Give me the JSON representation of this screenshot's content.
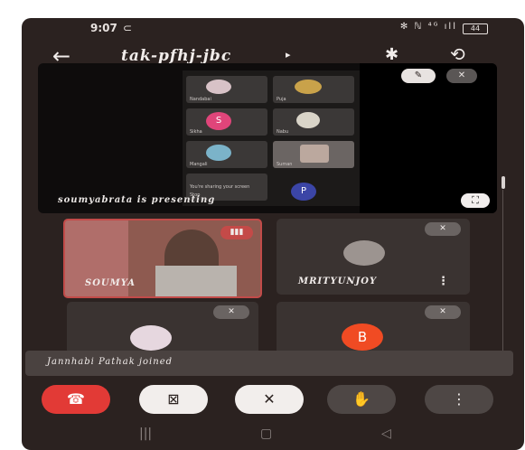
{
  "status": {
    "time": "9:07",
    "indicator": "⊂",
    "right": "✻ ℕ ⁴ᴳ ıll",
    "battery": "44"
  },
  "header": {
    "title": "tak-pfhj-jbc",
    "back_icon": "←",
    "play_icon": "▸",
    "bluetooth_icon": "✱",
    "rotate_icon": "⟲"
  },
  "screen_share": {
    "presenter_text": "soumyabrata is presenting",
    "thumbs": [
      {
        "name": "Nandabai"
      },
      {
        "name": "Puja"
      },
      {
        "name": "Sikha",
        "initial": "S"
      },
      {
        "name": "Nabu"
      },
      {
        "name": "Mangali"
      },
      {
        "name": "Suman"
      },
      {
        "name": "You're sharing your screen",
        "sub": "Stop"
      }
    ],
    "p_initial": "P",
    "pin_icon": "✎",
    "mic_off_icon": "✕",
    "fullscreen_icon": "⛶"
  },
  "tiles": [
    {
      "name": "SOUMYA",
      "mute": "▮▮▮"
    },
    {
      "name": "MRITYUNJOY",
      "mute": "✕"
    },
    {
      "name": "",
      "mute": "✕"
    },
    {
      "name": "",
      "initial": "B",
      "mute": "✕"
    }
  ],
  "toast": {
    "text": "Jannhabi Pathak joined"
  },
  "controls": {
    "end_call": "☎",
    "video_off": "⊠",
    "mic_off": "✕",
    "raise_hand": "✋",
    "more": "⋮"
  },
  "nav": {
    "recents": "|||",
    "home": "▢",
    "back": "◁"
  },
  "colors": {
    "end_call": "#e23a36",
    "tile": "#3a3331",
    "active_border": "#c24b49",
    "avatar_b": "#f04b23"
  }
}
